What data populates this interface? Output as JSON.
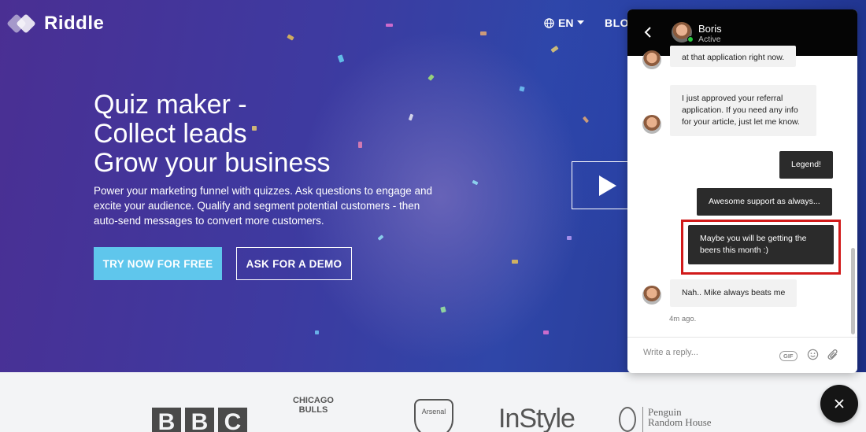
{
  "brand": {
    "name": "Riddle"
  },
  "nav": {
    "language": "EN",
    "blog": "BLOG"
  },
  "hero": {
    "headline": [
      "Quiz maker -",
      "Collect leads",
      "Grow your business"
    ],
    "subtext": "Power your marketing funnel with quizzes. Ask questions to engage and excite your audience. Qualify and segment potential customers - then auto-send messages to convert more customers.",
    "cta_primary": "TRY NOW FOR FREE",
    "cta_secondary": "ASK FOR A DEMO"
  },
  "clients": {
    "bbc": [
      "B",
      "B",
      "C"
    ],
    "bulls": [
      "CHICAGO",
      "BULLS"
    ],
    "arsenal": "Arsenal",
    "instyle": "InStyle",
    "penguin": [
      "Penguin",
      "Random House"
    ]
  },
  "chat": {
    "agent_name": "Boris",
    "agent_status": "Active",
    "messages": [
      {
        "from": "agent",
        "text": "at that application right now."
      },
      {
        "from": "agent",
        "text": "I just approved your referral application. If you need any info for your article, just let me know."
      },
      {
        "from": "user",
        "text": "Legend!"
      },
      {
        "from": "user",
        "text": "Awesome support as always..."
      },
      {
        "from": "user",
        "text": "Maybe you will be getting the beers this month :)"
      },
      {
        "from": "agent",
        "text": "Nah.. Mike always beats me"
      }
    ],
    "timestamp": "4m ago.",
    "reply_placeholder": "Write a reply...",
    "gif_label": "GIF"
  },
  "colors": {
    "accent": "#5fc6ec",
    "highlight": "#d11a1a",
    "chat_header": "#050505"
  }
}
